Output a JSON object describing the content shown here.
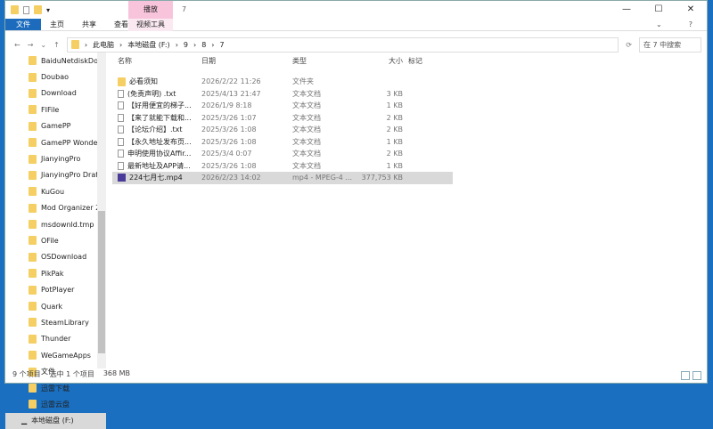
{
  "window": {
    "title": "7",
    "context_tab": "播放",
    "controls": [
      "—",
      "☐",
      "✕"
    ]
  },
  "ribbon": {
    "tabs": [
      "文件",
      "主页",
      "共享",
      "查看"
    ],
    "context_tool": "视频工具",
    "right": [
      "⌄",
      "?"
    ]
  },
  "address": {
    "path": [
      "此电脑",
      "本地磁盘 (F:)",
      "9",
      "8",
      "7"
    ],
    "search_placeholder": "在 7 中搜索"
  },
  "sidebar": {
    "items": [
      "BaiduNetdiskDov",
      "Doubao",
      "Download",
      "FIFile",
      "GamePP",
      "GamePP Wonder",
      "JianyingPro",
      "JianyingPro Draft",
      "KuGou",
      "Mod Organizer 2",
      "msdownld.tmp",
      "OFile",
      "OSDownload",
      "PikPak",
      "PotPlayer",
      "Quark",
      "SteamLibrary",
      "Thunder",
      "WeGameApps",
      "文件",
      "迅雷下载",
      "迅雷云盘"
    ],
    "drive": "本地磁盘 (F:)"
  },
  "columns": [
    "名称",
    "日期",
    "类型",
    "大小",
    "标记"
  ],
  "files": [
    {
      "name": "必看须知",
      "date": "2026/2/22 11:26",
      "type": "文件夹",
      "size": "",
      "icon": "folder"
    },
    {
      "name": "(免责声明) .txt",
      "date": "2025/4/13 21:47",
      "type": "文本文档",
      "size": "3 KB",
      "icon": "doc"
    },
    {
      "name": "【好用便宜的梯子...",
      "date": "2026/1/9 8:18",
      "type": "文本文档",
      "size": "1 KB",
      "icon": "doc"
    },
    {
      "name": "【来了就能下载和...",
      "date": "2025/3/26 1:07",
      "type": "文本文档",
      "size": "2 KB",
      "icon": "doc"
    },
    {
      "name": "【论坛介绍】.txt",
      "date": "2025/3/26 1:08",
      "type": "文本文档",
      "size": "2 KB",
      "icon": "doc"
    },
    {
      "name": "【永久地址发布页...",
      "date": "2025/3/26 1:08",
      "type": "文本文档",
      "size": "1 KB",
      "icon": "doc"
    },
    {
      "name": "申明使用协议Affir...",
      "date": "2025/3/4 0:07",
      "type": "文本文档",
      "size": "2 KB",
      "icon": "doc"
    },
    {
      "name": "最新地址及APP请...",
      "date": "2025/3/26 1:08",
      "type": "文本文档",
      "size": "1 KB",
      "icon": "doc"
    },
    {
      "name": "224七月七.mp4",
      "date": "2026/2/23 14:02",
      "type": "mp4 - MPEG-4 ...",
      "size": "377,753 KB",
      "icon": "video",
      "selected": true
    }
  ],
  "status": {
    "count": "9 个项目",
    "selected": "选中 1 个项目",
    "size": "368 MB"
  }
}
